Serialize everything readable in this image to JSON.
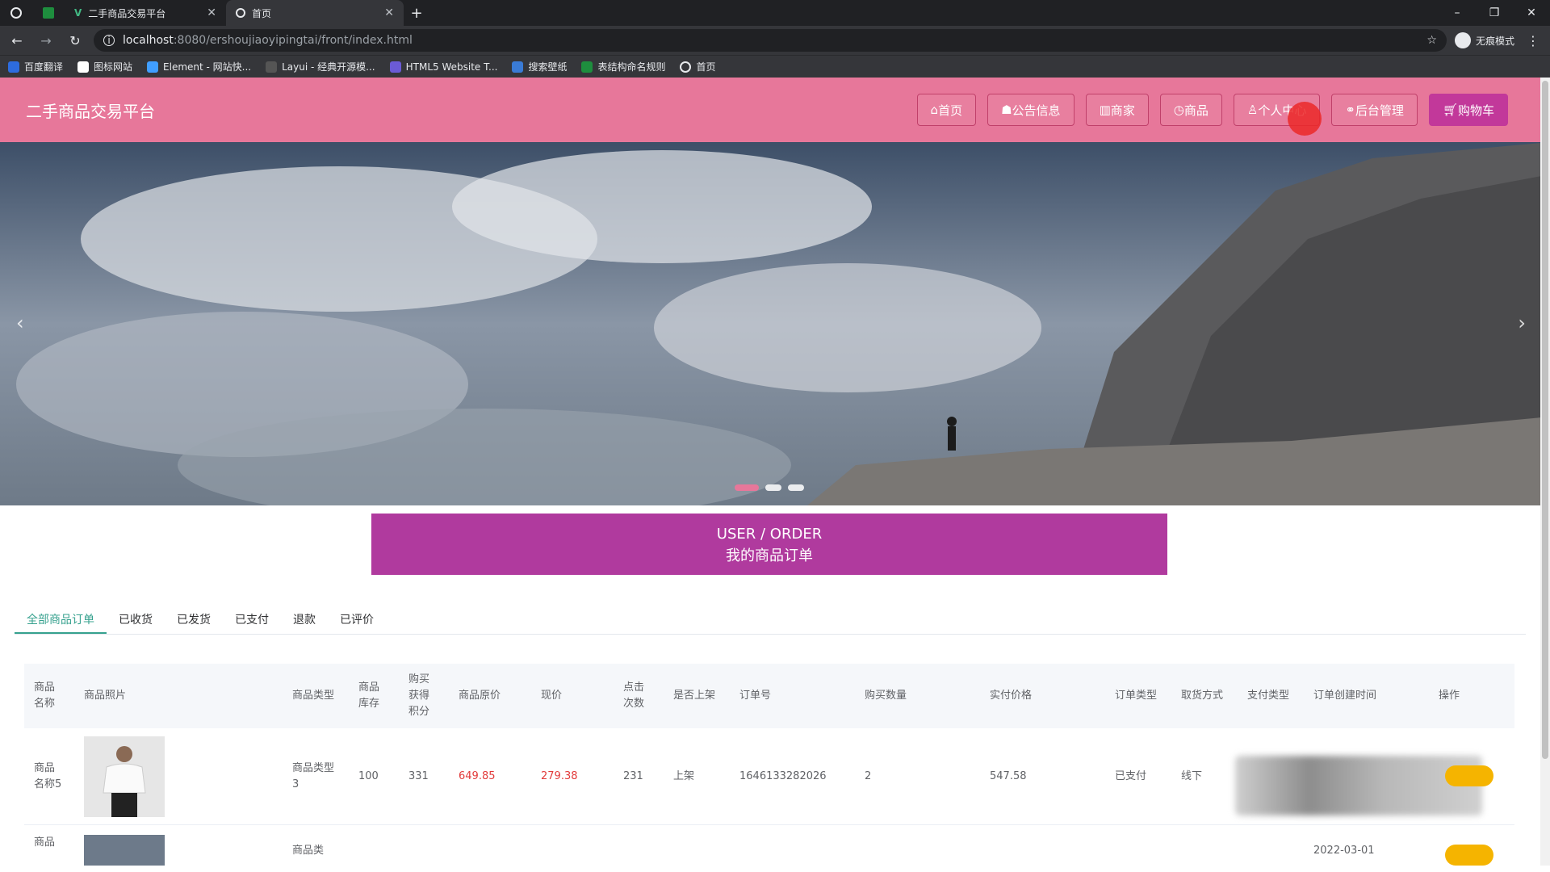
{
  "browser": {
    "tabs": [
      {
        "title": "二手商品交易平台",
        "active": false
      },
      {
        "title": "首页",
        "active": true
      }
    ],
    "url_host": "localhost",
    "url_path": ":8080/ershoujiaoyipingtai/front/index.html",
    "profile_label": "无痕模式",
    "bookmarks": [
      "百度翻译",
      "图标网站",
      "Element - 网站快...",
      "Layui - 经典开源模...",
      "HTML5 Website T...",
      "搜索壁纸",
      "表结构命名规则",
      "首页"
    ]
  },
  "site": {
    "title": "二手商品交易平台",
    "nav": [
      "首页",
      "公告信息",
      "商家",
      "商品",
      "个人中心",
      "后台管理",
      "购物车"
    ],
    "nav_icons": [
      "home-icon",
      "hat-icon",
      "shop-icon",
      "clock-icon",
      "user-icon",
      "link-icon",
      "cart-icon"
    ],
    "accent": "#e7779a",
    "purple": "#b03a9e"
  },
  "order_banner": {
    "en": "USER / ORDER",
    "zh": "我的商品订单"
  },
  "order_tabs": [
    "全部商品订单",
    "已收货",
    "已发货",
    "已支付",
    "退款",
    "已评价"
  ],
  "table": {
    "headers": [
      "商品名称",
      "商品照片",
      "商品类型",
      "商品库存",
      "购买获得积分",
      "商品原价",
      "现价",
      "点击次数",
      "是否上架",
      "订单号",
      "购买数量",
      "实付价格",
      "订单类型",
      "取货方式",
      "支付类型",
      "订单创建时间",
      "操作"
    ],
    "rows": [
      {
        "name": "商品名称5",
        "type": "商品类型3",
        "stock": "100",
        "points": "331",
        "orig_price": "649.85",
        "price": "279.38",
        "clicks": "231",
        "on_shelf": "上架",
        "order_no": "1646133282026",
        "qty": "2",
        "paid": "547.58",
        "order_type": "已支付",
        "pickup": "线下"
      },
      {
        "name": "商品",
        "type": "商品类",
        "created": "2022-03-01"
      }
    ]
  }
}
